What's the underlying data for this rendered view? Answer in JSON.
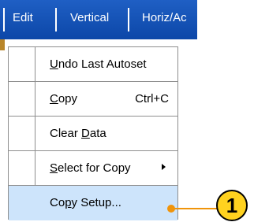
{
  "menubar": {
    "tabs": [
      {
        "label": "Edit"
      },
      {
        "label": "Vertical"
      },
      {
        "label": "Horiz/Ac"
      }
    ]
  },
  "menu": {
    "items": [
      {
        "pre": "",
        "u": "U",
        "post": "ndo Last Autoset",
        "shortcut": "",
        "submenu": false
      },
      {
        "pre": "",
        "u": "C",
        "post": "opy",
        "shortcut": "Ctrl+C",
        "submenu": false
      },
      {
        "pre": "Clear ",
        "u": "D",
        "post": "ata",
        "shortcut": "",
        "submenu": false
      },
      {
        "pre": "",
        "u": "S",
        "post": "elect for Copy",
        "shortcut": "",
        "submenu": true
      },
      {
        "pre": "Co",
        "u": "p",
        "post": "y Setup...",
        "shortcut": "",
        "submenu": false,
        "highlighted": true
      }
    ]
  },
  "callout": {
    "number": "1"
  },
  "colors": {
    "menubar": "#0c47a8",
    "highlight": "#cde4fb",
    "callout_fill": "#ffd21f",
    "callout_line": "#f0940a"
  }
}
